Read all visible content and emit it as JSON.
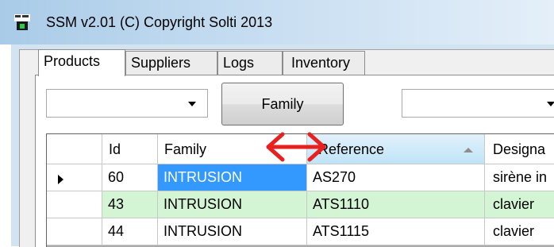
{
  "window": {
    "title": "SSM v2.01 (C) Copyright Solti 2013"
  },
  "tabs": [
    {
      "label": "Products",
      "active": true
    },
    {
      "label": "Suppliers",
      "active": false
    },
    {
      "label": "Logs",
      "active": false
    },
    {
      "label": "Inventory",
      "active": false
    }
  ],
  "filters": {
    "combo1_value": "",
    "family_button": "Family",
    "combo2_value": ""
  },
  "grid": {
    "columns": [
      "Id",
      "Family",
      "Reference",
      "Designa"
    ],
    "sorted_column": "Reference",
    "rows": [
      {
        "id": "60",
        "family": "INTRUSION",
        "reference": "AS270",
        "designation": "sirène in",
        "color": "white",
        "selected": true,
        "current": true
      },
      {
        "id": "43",
        "family": "INTRUSION",
        "reference": "ATS1110",
        "designation": "clavier",
        "color": "green",
        "selected": false,
        "current": false
      },
      {
        "id": "44",
        "family": "INTRUSION",
        "reference": "ATS1115",
        "designation": "clavier",
        "color": "white",
        "selected": false,
        "current": false
      }
    ]
  },
  "colors": {
    "selection": "#3399ff",
    "row_green": "#d4f5d4",
    "annotation_arrow": "#e8201f"
  },
  "icons": {
    "app": "app-icon",
    "combo_arrow": "chevron-down-icon",
    "sort": "sort-ascending-icon",
    "row_pointer": "current-row-icon",
    "annotation": "double-arrow-icon"
  }
}
